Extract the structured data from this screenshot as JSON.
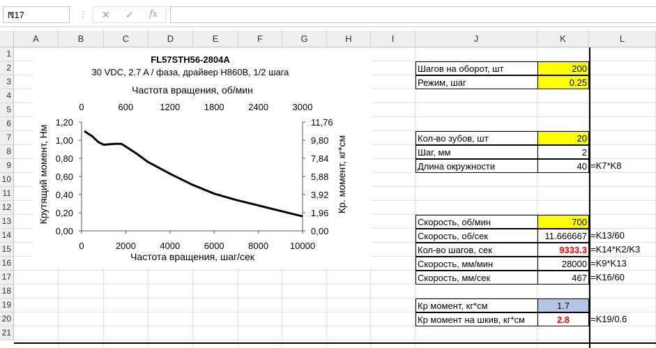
{
  "formula_bar": {
    "name_box": "N17",
    "fx_label": "fx",
    "formula": ""
  },
  "columns": [
    "A",
    "B",
    "C",
    "D",
    "E",
    "F",
    "G",
    "H",
    "I",
    "J",
    "K",
    "L"
  ],
  "rows": [
    "1",
    "2",
    "3",
    "4",
    "5",
    "6",
    "7",
    "8",
    "9",
    "10",
    "11",
    "12",
    "13",
    "14",
    "15",
    "16",
    "17",
    "18",
    "19",
    "20",
    "21"
  ],
  "chart_data": {
    "type": "line",
    "title": "FL57STH56-2804A",
    "subtitle": "30 VDC, 2.7 A / фаза, драйвер H860B, 1/2 шага",
    "xlabel": "Частота вращения, шаг/сек",
    "x2label": "Частота вращения, об/мин",
    "ylabel": "Крутящий момент, Нм",
    "y2label": "Кр. момент, кг*см",
    "xlim": [
      0,
      10000
    ],
    "ylim": [
      0,
      1.2
    ],
    "y2lim": [
      0,
      11.76
    ],
    "x_ticks": [
      "0",
      "2000",
      "4000",
      "6000",
      "8000",
      "10000"
    ],
    "x2_ticks": [
      "0",
      "600",
      "1200",
      "1800",
      "2400",
      "3000"
    ],
    "y_ticks": [
      "0,00",
      "0,20",
      "0,40",
      "0,60",
      "0,80",
      "1,00",
      "1,20"
    ],
    "y2_ticks": [
      "0,00",
      "1,96",
      "3,92",
      "5,88",
      "7,84",
      "9,80",
      "11,76"
    ],
    "series": [
      {
        "x": [
          125,
          500,
          750,
          1000,
          1500,
          1800,
          2000,
          2500,
          3000,
          4000,
          5000,
          6000,
          7000,
          8000,
          9000,
          10000
        ],
        "y": [
          1.1,
          1.04,
          0.98,
          0.95,
          0.96,
          0.96,
          0.93,
          0.85,
          0.76,
          0.63,
          0.51,
          0.41,
          0.34,
          0.28,
          0.22,
          0.16
        ]
      }
    ]
  },
  "params": [
    {
      "row": 2,
      "label": "Шагов на оборот, шт",
      "value": "200",
      "style": "yellow",
      "note": ""
    },
    {
      "row": 3,
      "label": "Режим, шаг",
      "value": "0.25",
      "style": "yellow",
      "note": ""
    },
    {
      "row": 7,
      "label": "Кол-во зубов, шт",
      "value": "20",
      "style": "yellow",
      "note": ""
    },
    {
      "row": 8,
      "label": "Шаг, мм",
      "value": "2",
      "style": "",
      "note": ""
    },
    {
      "row": 9,
      "label": "Длина окружности",
      "value": "40",
      "style": "",
      "note": "=K7*K8"
    },
    {
      "row": 13,
      "label": "Скорость, об/мин",
      "value": "700",
      "style": "yellow",
      "note": ""
    },
    {
      "row": 14,
      "label": "Скорость, об/сек",
      "value": "11.666667",
      "style": "",
      "note": "=K13/60"
    },
    {
      "row": 15,
      "label": "Кол-во шагов, сек",
      "value": "9333.3",
      "style": "red",
      "note": "=K14*K2/K3"
    },
    {
      "row": 16,
      "label": "Скорость, мм/мин",
      "value": "28000",
      "style": "",
      "note": "=K9*K13"
    },
    {
      "row": 17,
      "label": "Скорость, мм/сек",
      "value": "467",
      "style": "",
      "note": "=K16/60"
    },
    {
      "row": 19,
      "label": "Кр момент, кг*см",
      "value": "1.7",
      "style": "blue",
      "note": ""
    },
    {
      "row": 20,
      "label": "Кр момент на шкив, кг*см",
      "value": "2.8",
      "style": "redc",
      "note": "=K19/0.6"
    }
  ]
}
